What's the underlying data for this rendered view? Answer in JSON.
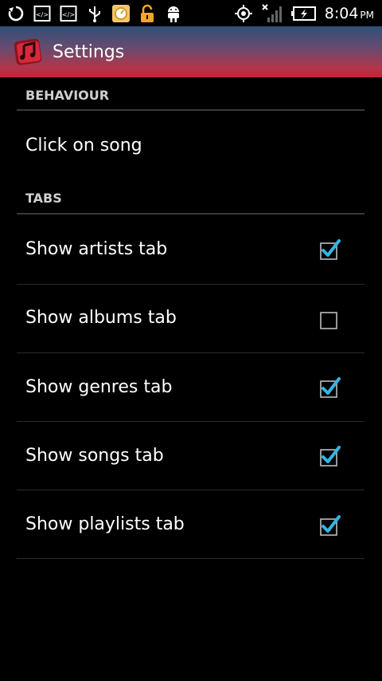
{
  "status_bar": {
    "left_icons": [
      "sync-icon",
      "code-icon",
      "code-icon",
      "usb-icon",
      "clock-app-icon",
      "unlock-icon",
      "android-icon"
    ],
    "right_icons": [
      "gps-icon",
      "signal-icon",
      "battery-charging-icon"
    ],
    "time": "8:04",
    "ampm": "PM"
  },
  "action_bar": {
    "title": "Settings",
    "gradient": [
      "#2f4f79",
      "#c3233a"
    ]
  },
  "sections": {
    "behaviour": {
      "title": "BEHAVIOUR",
      "items": [
        {
          "label": "Click on song"
        }
      ]
    },
    "tabs": {
      "title": "TABS",
      "items": [
        {
          "label": "Show artists tab",
          "checked": true
        },
        {
          "label": "Show albums tab",
          "checked": false
        },
        {
          "label": "Show genres tab",
          "checked": true
        },
        {
          "label": "Show songs tab",
          "checked": true
        },
        {
          "label": "Show playlists tab",
          "checked": true
        }
      ]
    }
  },
  "colors": {
    "background": "#000000",
    "check_accent": "#33b5e5",
    "category_text": "#cfcfcf"
  }
}
